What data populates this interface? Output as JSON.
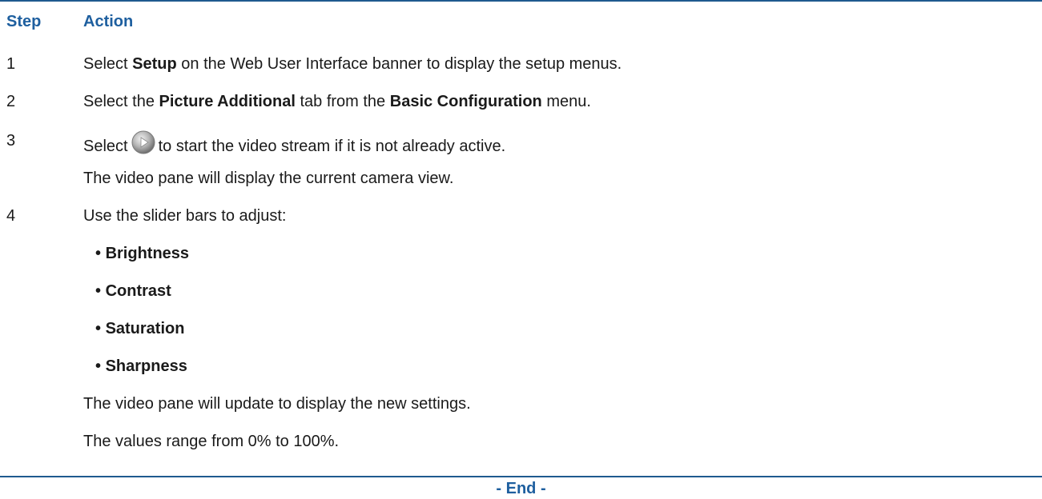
{
  "table": {
    "header_step": "Step",
    "header_action": "Action"
  },
  "steps": [
    {
      "number": "1",
      "pre": "Select ",
      "bold1": "Setup",
      "post": " on the Web User Interface banner to display the setup menus."
    },
    {
      "number": "2",
      "pre": "Select the ",
      "bold1": "Picture Additional",
      "mid": " tab from the ",
      "bold2": "Basic Configuration",
      "post": " menu."
    },
    {
      "number": "3",
      "pre": "Select",
      "icon": "play-button-icon",
      "post": "to start the video stream if it is not already active.",
      "note": "The video pane will display the current camera view."
    },
    {
      "number": "4",
      "intro": "Use the slider bars to adjust:",
      "bullets": [
        "Brightness",
        "Contrast",
        "Saturation",
        "Sharpness"
      ],
      "note1": "The video pane will update to display the new settings.",
      "note2": "The values range from 0% to 100%."
    }
  ],
  "footer": {
    "end_text": "- End -"
  },
  "colors": {
    "accent": "#1e5f9f",
    "rule": "#1f5a8f",
    "text": "#1a1a1a"
  }
}
